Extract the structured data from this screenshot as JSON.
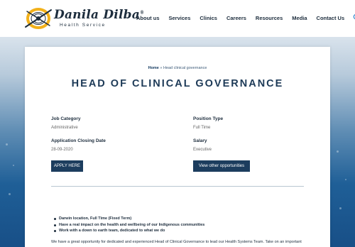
{
  "logo": {
    "title": "Danila Dilba",
    "trademark": "®",
    "subtitle": "Health Service",
    "colors": {
      "ring": "#f2b11b",
      "ink": "#1d2d3d"
    }
  },
  "nav": {
    "items": [
      "About us",
      "Services",
      "Clinics",
      "Careers",
      "Resources",
      "Media",
      "Contact Us"
    ],
    "search_icon": "search-icon",
    "search_color": "#3a8fd0"
  },
  "breadcrumb": {
    "home": "Home",
    "separator": " » ",
    "current": "Head clinical governance"
  },
  "page_title": "HEAD OF CLINICAL GOVERNANCE",
  "details": {
    "job_category": {
      "label": "Job Category",
      "value": "Administrative"
    },
    "position_type": {
      "label": "Position Type",
      "value": "Full Time"
    },
    "closing_date": {
      "label": "Application Closing Date",
      "value": "28-09-2020"
    },
    "salary": {
      "label": "Salary",
      "value": "Executive"
    }
  },
  "buttons": {
    "apply": "APPLY HERE",
    "other": "View other opportunities"
  },
  "highlights": [
    "Darwin location, Full Time (Fixed Term)",
    "Have a real impact on the health and wellbeing of our Indigenous communities",
    "Work with a down to earth team, dedicated to what we do"
  ],
  "intro": "We have a great opportunity for dedicated and experienced Head of Clinical Governance to lead our Health Systems Team. Take on an important",
  "colors": {
    "primary": "#1c3d5e",
    "heading": "#1d3a57",
    "background_blue": "#1f5f97"
  }
}
